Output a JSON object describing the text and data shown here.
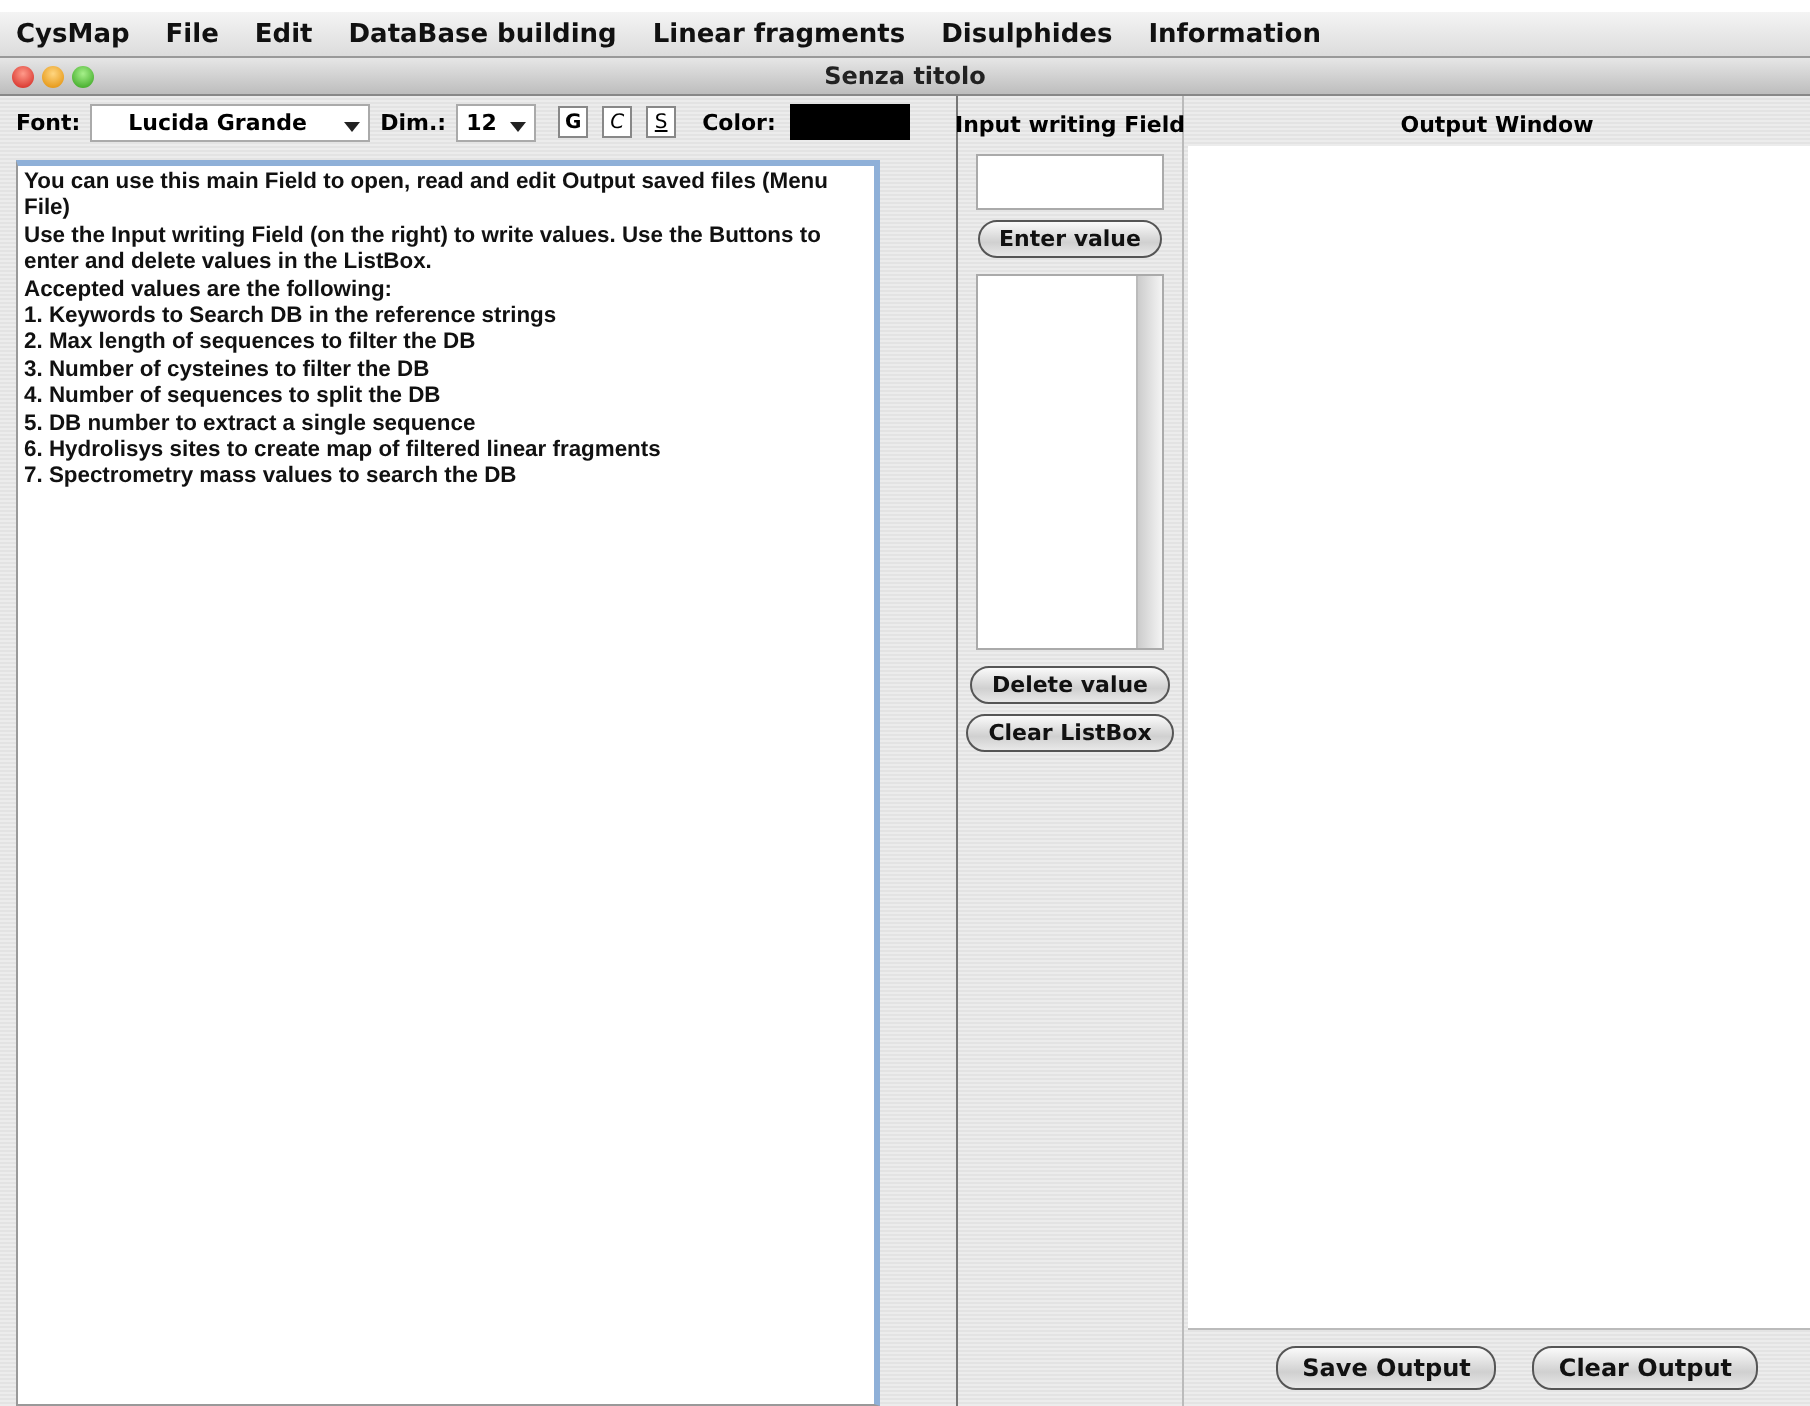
{
  "menu_bar": {
    "app": "CysMap",
    "items": [
      "File",
      "Edit",
      "DataBase building",
      "Linear fragments",
      "Disulphides",
      "Information"
    ]
  },
  "window": {
    "title": "Senza titolo"
  },
  "toolbar": {
    "font_label": "Font:",
    "font_value": "Lucida Grande",
    "size_label": "Dim.:",
    "size_value": "12",
    "style_buttons": [
      {
        "label": "G",
        "kind": "bold"
      },
      {
        "label": "C",
        "kind": "italic"
      },
      {
        "label": "S",
        "kind": "underline"
      }
    ],
    "color_label": "Color:",
    "color": "#000000"
  },
  "main_field": {
    "lines": [
      "You can use this main Field to open, read and edit Output saved files (Menu",
      "File)",
      "Use the Input writing Field (on the right) to write values. Use the Buttons to",
      "enter and delete values in the ListBox.",
      "Accepted values are the following:",
      "1. Keywords to Search DB in the reference strings",
      "2. Max length of sequences to filter the DB",
      "3. Number of cysteines to filter the DB",
      "4. Number of sequences to split the DB",
      "5. DB number to extract a single sequence",
      "6. Hydrolisys sites to create map of filtered linear fragments",
      "7. Spectrometry mass values to search the DB"
    ]
  },
  "input_panel": {
    "title": "Input writing Field",
    "enter_button": "Enter value",
    "delete_button": "Delete value",
    "clear_button": "Clear ListBox"
  },
  "output_panel": {
    "title": "Output Window",
    "save_button": "Save Output",
    "clear_button": "Clear Output"
  }
}
